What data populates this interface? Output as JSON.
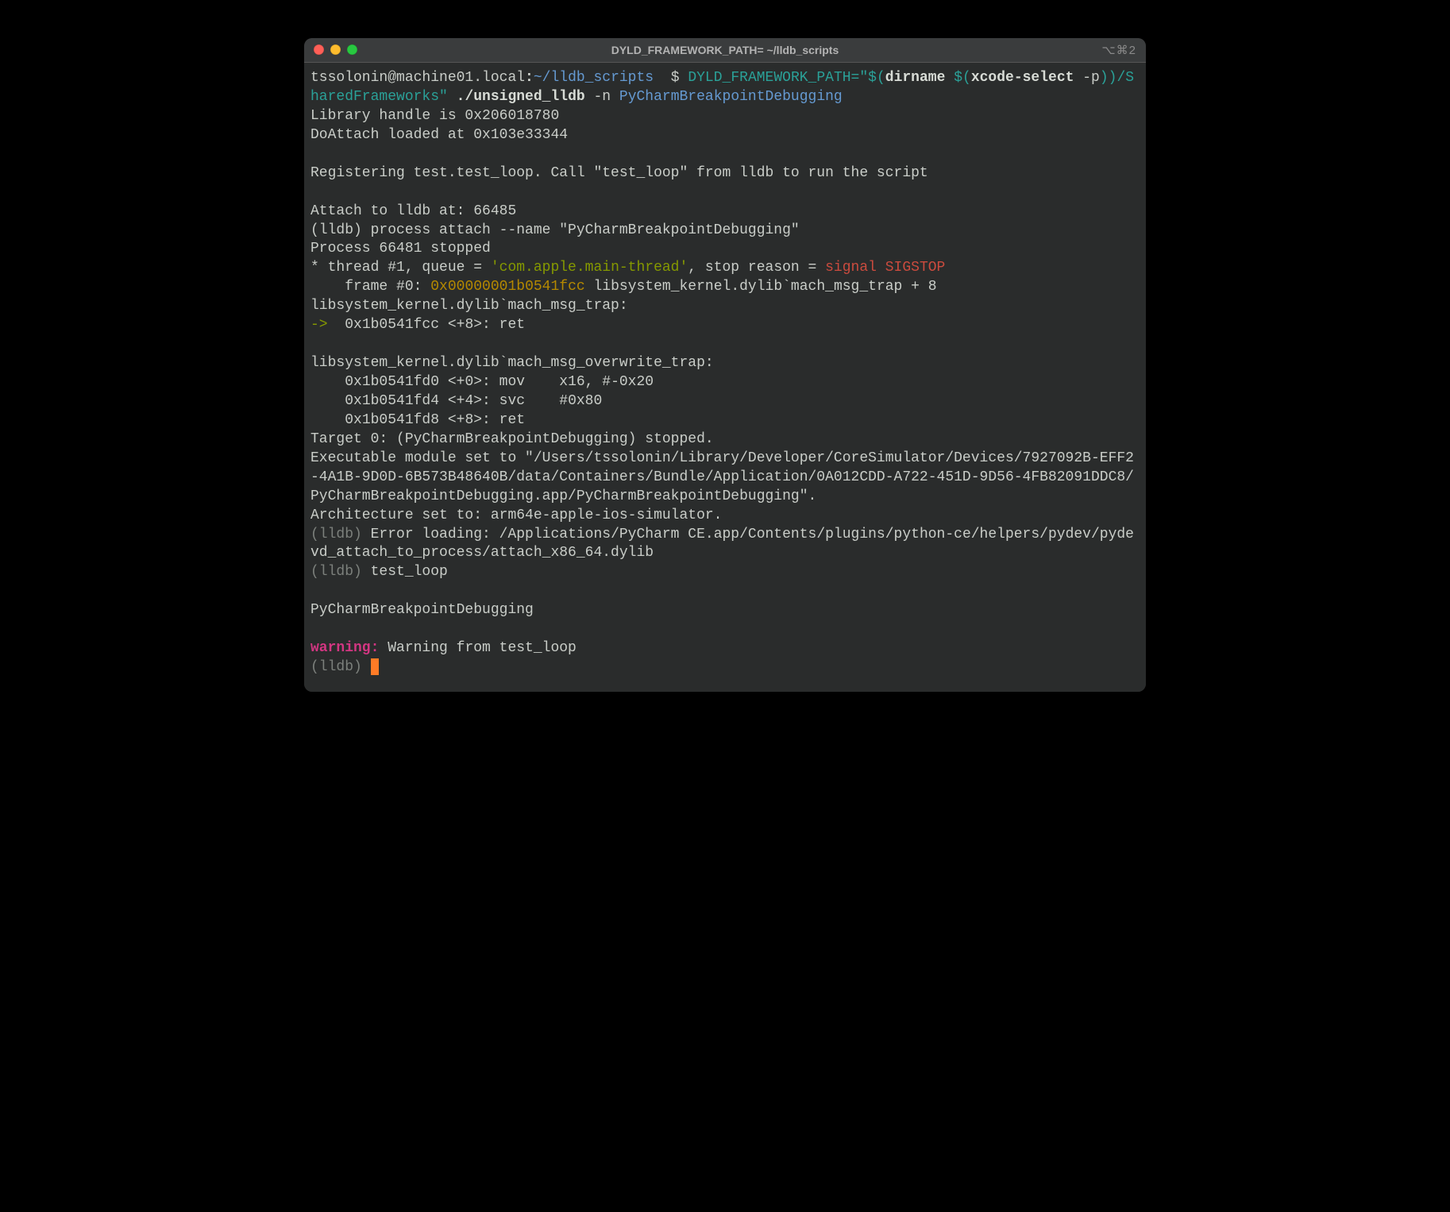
{
  "window": {
    "title": "DYLD_FRAMEWORK_PATH= ~/lldb_scripts",
    "shortcut": "⌥⌘2"
  },
  "prompt": {
    "user_host": "tssolonin@machine01.local",
    "cwd": "~/lldb_scripts",
    "sigil": "$"
  },
  "cmd": {
    "var_prefix": "DYLD_FRAMEWORK_PATH=",
    "quote1": "\"$(",
    "dirname": "dirname",
    "space_dollar_paren": " $(",
    "xcode_select": "xcode-select",
    "flag_p": " -p",
    "close1": ")",
    "close2": ")",
    "path_suffix": "/SharedFrameworks",
    "quote_close": "\"",
    "script": " ./unsigned_lldb",
    "flag_n": " -n ",
    "arg": "PyCharmBreakpointDebugging"
  },
  "out": {
    "lib_handle": "Library handle is 0x206018780",
    "doattach": "DoAttach loaded at 0x103e33344",
    "blank": "",
    "register": "Registering test.test_loop. Call \"test_loop\" from lldb to run the script",
    "attach_at": "Attach to lldb at: 66485",
    "lldb_attach": "(lldb) process attach --name \"PyCharmBreakpointDebugging\"",
    "proc_stopped": "Process 66481 stopped",
    "thread_pre": "* thread #1, queue = ",
    "thread_queue": "'com.apple.main-thread'",
    "thread_mid": ", stop reason = ",
    "thread_sig": "signal SIGSTOP",
    "frame_pre": "    frame #0: ",
    "frame_addr": "0x00000001b0541fcc",
    "frame_post": " libsystem_kernel.dylib`mach_msg_trap + 8",
    "trap_label": "libsystem_kernel.dylib`mach_msg_trap:",
    "arrow": "->  ",
    "pc_line": "0x1b0541fcc <+8>: ret",
    "over_label": "libsystem_kernel.dylib`mach_msg_overwrite_trap:",
    "l0": "    0x1b0541fd0 <+0>: mov    x16, #-0x20",
    "l1": "    0x1b0541fd4 <+4>: svc    #0x80",
    "l2": "    0x1b0541fd8 <+8>: ret",
    "target": "Target 0: (PyCharmBreakpointDebugging) stopped.",
    "exec_mod": "Executable module set to \"/Users/tssolonin/Library/Developer/CoreSimulator/Devices/7927092B-EFF2-4A1B-9D0D-6B573B48640B/data/Containers/Bundle/Application/0A012CDD-A722-451D-9D56-4FB82091DDC8/PyCharmBreakpointDebugging.app/PyCharmBreakpointDebugging\".",
    "arch": "Architecture set to: arm64e-apple-ios-simulator.",
    "lldb_dim": "(lldb) ",
    "err_load": "Error loading: /Applications/PyCharm CE.app/Contents/plugins/python-ce/helpers/pydev/pydevd_attach_to_process/attach_x86_64.dylib",
    "test_loop_cmd": "test_loop",
    "proc_name": "PyCharmBreakpointDebugging",
    "warn_label": "warning:",
    "warn_text": " Warning from test_loop",
    "final_prompt": "(lldb) "
  }
}
